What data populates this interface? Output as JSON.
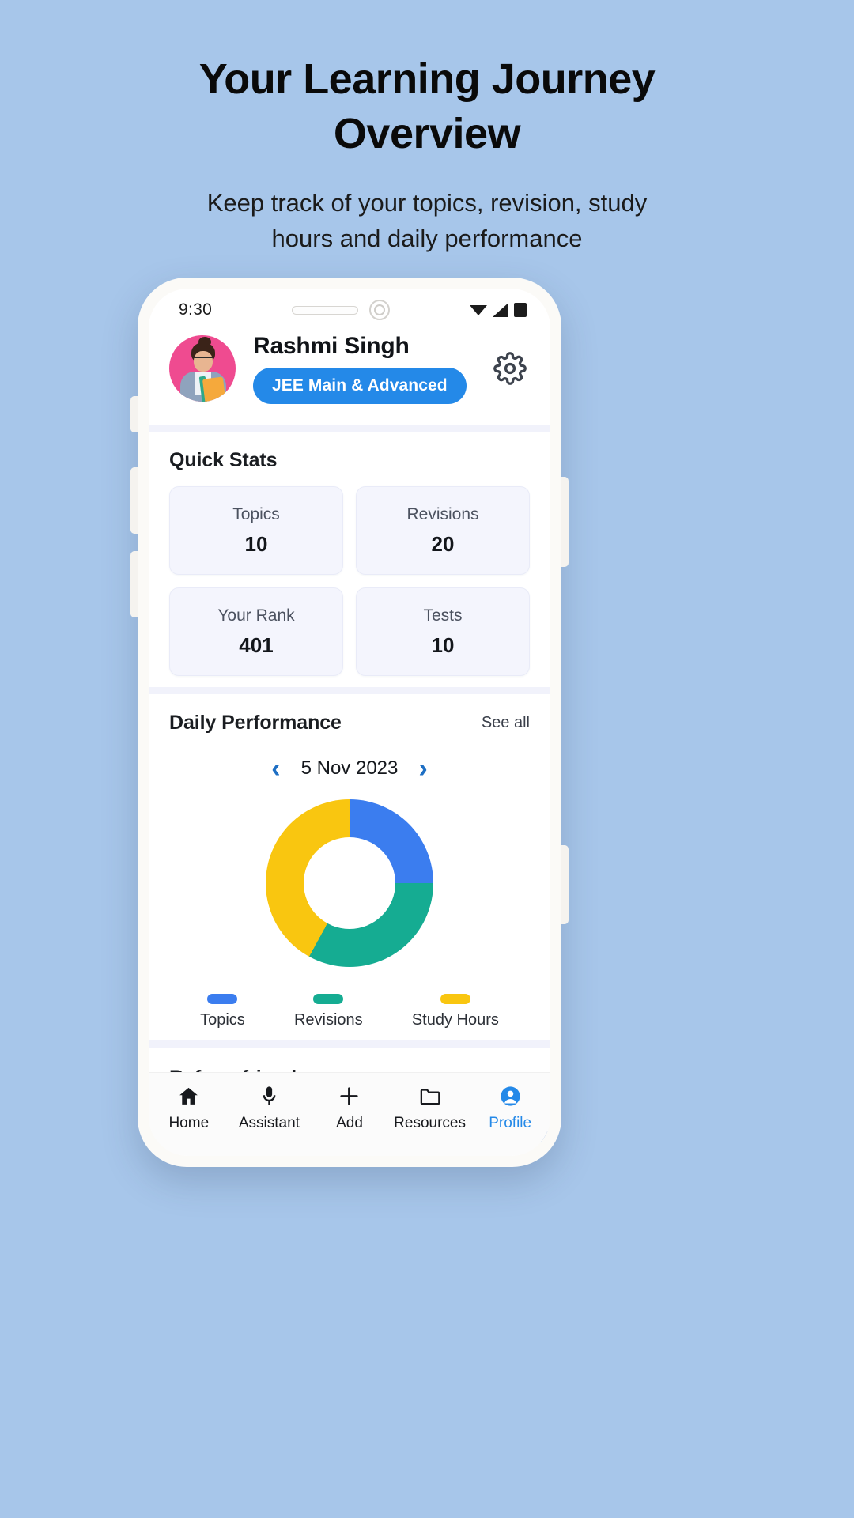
{
  "promo": {
    "title": "Your Learning Journey Overview",
    "subtitle": "Keep track of your topics, revision, study hours and daily performance",
    "background_color": "#a7c6ea"
  },
  "status_bar": {
    "time": "9:30",
    "icons": [
      "wifi-triangle-icon",
      "signal-icon",
      "battery-icon"
    ]
  },
  "profile": {
    "name": "Rashmi Singh",
    "exam_badge": "JEE Main & Advanced",
    "badge_color": "#2489e8",
    "avatar_name": "user-avatar",
    "settings_icon": "gear-icon"
  },
  "quick_stats": {
    "title": "Quick Stats",
    "cards": [
      {
        "label": "Topics",
        "value": "10"
      },
      {
        "label": "Revisions",
        "value": "20"
      },
      {
        "label": "Your Rank",
        "value": "401"
      },
      {
        "label": "Tests",
        "value": "10"
      }
    ]
  },
  "daily_performance": {
    "title": "Daily Performance",
    "see_all": "See all",
    "prev_icon": "chevron-left-icon",
    "next_icon": "chevron-right-icon",
    "date": "5 Nov 2023"
  },
  "chart_data": {
    "type": "pie",
    "title": "Daily Performance",
    "subtype": "donut",
    "categories": [
      "Topics",
      "Revisions",
      "Study Hours"
    ],
    "values": [
      25,
      33,
      42
    ],
    "colors": [
      "#3b7def",
      "#15ac92",
      "#f9c610"
    ],
    "legend_position": "bottom",
    "grid": false
  },
  "refer": {
    "title": "Refer a friend"
  },
  "bottom_nav": {
    "active_color": "#2489e8",
    "items": [
      {
        "label": "Home",
        "icon": "home-icon",
        "active": false
      },
      {
        "label": "Assistant",
        "icon": "microphone-icon",
        "active": false
      },
      {
        "label": "Add",
        "icon": "plus-icon",
        "active": false
      },
      {
        "label": "Resources",
        "icon": "folder-icon",
        "active": false
      },
      {
        "label": "Profile",
        "icon": "person-circle-icon",
        "active": true
      }
    ]
  }
}
